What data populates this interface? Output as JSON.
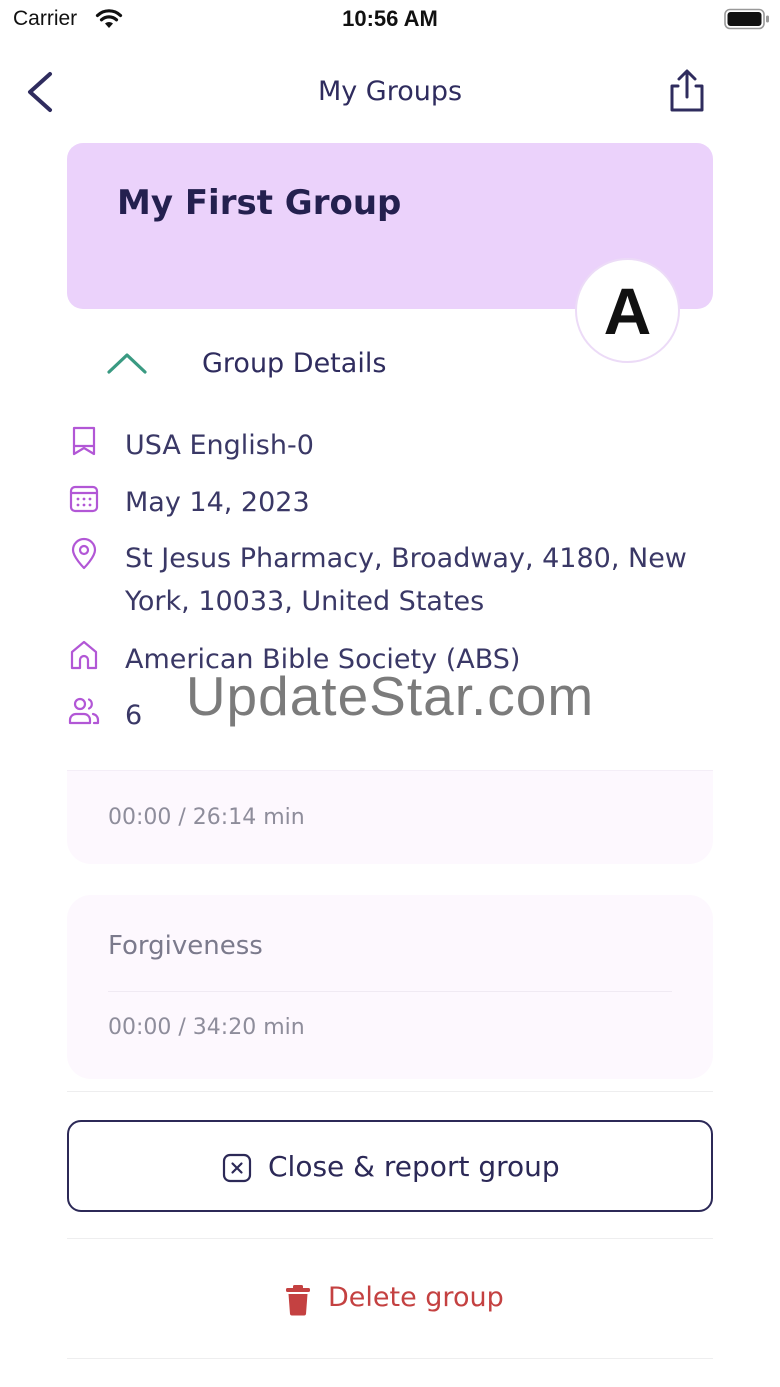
{
  "status_bar": {
    "carrier": "Carrier",
    "time": "10:56 AM"
  },
  "nav": {
    "title": "My Groups",
    "back_icon": "chevron-left-icon",
    "share_icon": "share-icon"
  },
  "group": {
    "name": "My First Group",
    "avatar_letter": "A",
    "card_color": "#ebd2fb"
  },
  "details": {
    "toggle_label": "Group Details",
    "language": "USA English-0",
    "date": "May 14, 2023",
    "location_line1": "St Jesus Pharmacy, Broadway, 4180, New",
    "location_line2": "York, 10033, United States",
    "organization": "American Bible Society (ABS)",
    "members": "6"
  },
  "watermark": "UpdateStar.com",
  "sessions": [
    {
      "title": "",
      "time": "00:00 / 26:14 min"
    },
    {
      "title": "Forgiveness",
      "time": "00:00 / 34:20 min"
    }
  ],
  "actions": {
    "close_report_label": "Close & report group",
    "delete_label": "Delete group",
    "delete_color": "#c44141"
  }
}
